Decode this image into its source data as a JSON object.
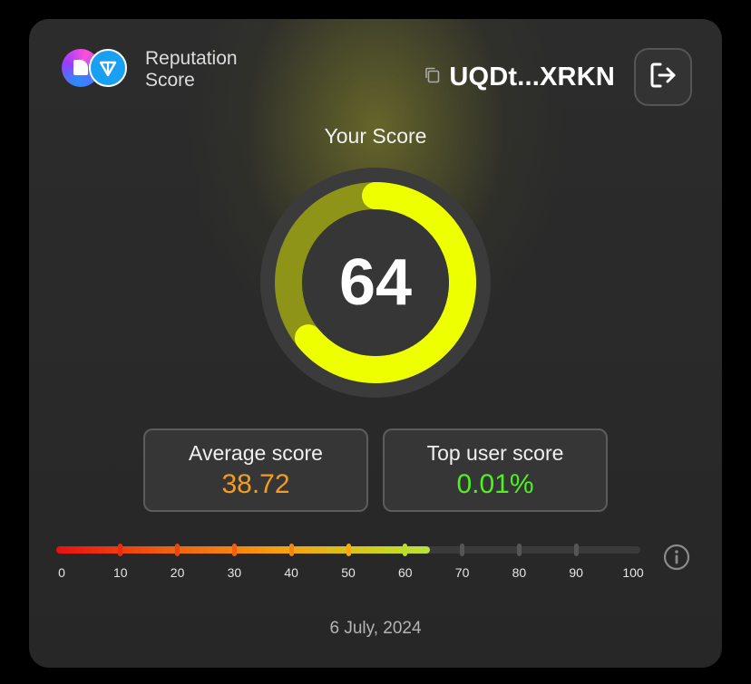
{
  "header": {
    "brand_line1": "Reputation",
    "brand_line2": "Score",
    "wallet_address": "UQDt...XRKN",
    "icons": {
      "logo_a": "book-logo-icon",
      "logo_b": "ton-diamond-icon",
      "copy": "copy-icon",
      "logout": "logout-icon"
    }
  },
  "score": {
    "title": "Your Score",
    "value": 64,
    "max": 100,
    "ring_color": "#eeff00"
  },
  "stats": {
    "average": {
      "label": "Average score",
      "value": "38.72",
      "color": "#f39c1f"
    },
    "top_user": {
      "label": "Top user score",
      "value": "0.01%",
      "color": "#4ef021"
    }
  },
  "scale": {
    "ticks": [
      0,
      10,
      20,
      30,
      40,
      50,
      60,
      70,
      80,
      90,
      100
    ],
    "tick_labels": [
      "0",
      "10",
      "20",
      "30",
      "40",
      "50",
      "60",
      "70",
      "80",
      "90",
      "100"
    ],
    "current": 64,
    "info_icon": "info-icon"
  },
  "footer": {
    "date": "6 July, 2024"
  }
}
